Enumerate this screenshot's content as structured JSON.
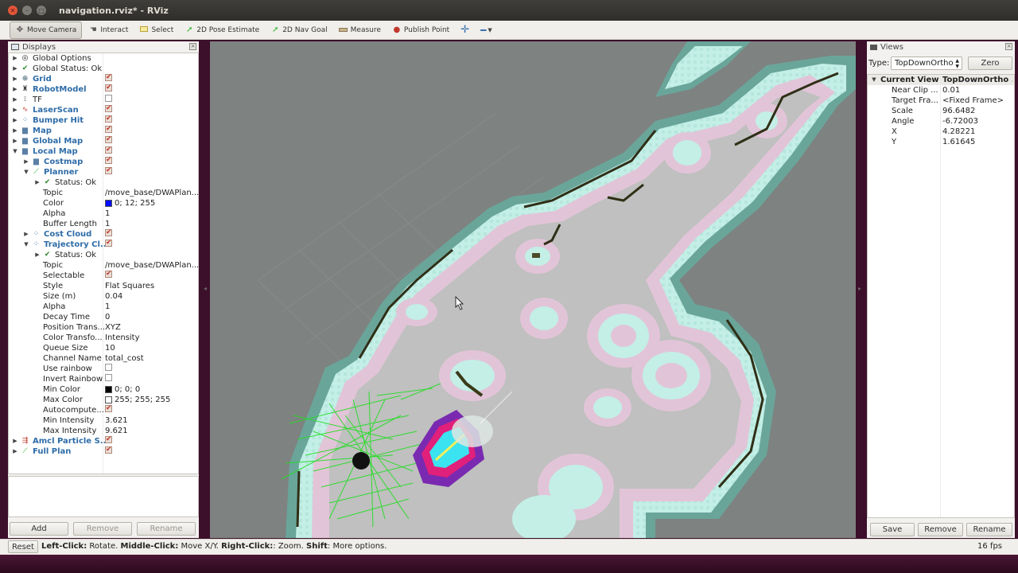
{
  "window": {
    "title": "navigation.rviz* - RViz"
  },
  "toolbar": {
    "tools": [
      {
        "label": "Move Camera",
        "icon": "camera-move-icon"
      },
      {
        "label": "Interact",
        "icon": "hand-icon"
      },
      {
        "label": "Select",
        "icon": "select-box-icon"
      },
      {
        "label": "2D Pose Estimate",
        "icon": "green-arrow-icon"
      },
      {
        "label": "2D Nav Goal",
        "icon": "green-arrow-icon"
      },
      {
        "label": "Measure",
        "icon": "ruler-icon"
      },
      {
        "label": "Publish Point",
        "icon": "map-pin-icon"
      }
    ]
  },
  "displays": {
    "title": "Displays",
    "rows": [
      {
        "label": "Global Options"
      },
      {
        "label": "Global Status: Ok"
      },
      {
        "label": "Grid"
      },
      {
        "label": "RobotModel"
      },
      {
        "label": "TF"
      },
      {
        "label": "LaserScan"
      },
      {
        "label": "Bumper Hit"
      },
      {
        "label": "Map"
      },
      {
        "label": "Global Map"
      },
      {
        "label": "Local Map"
      },
      {
        "label": "Costmap"
      },
      {
        "label": "Planner"
      },
      {
        "label": "Status: Ok"
      },
      {
        "label": "Topic",
        "value": "/move_base/DWAPlan..."
      },
      {
        "label": "Color",
        "value": "0; 12; 255"
      },
      {
        "label": "Alpha",
        "value": "1"
      },
      {
        "label": "Buffer Length",
        "value": "1"
      },
      {
        "label": "Cost Cloud"
      },
      {
        "label": "Trajectory Cl..."
      },
      {
        "label": "Status: Ok"
      },
      {
        "label": "Topic",
        "value": "/move_base/DWAPlan..."
      },
      {
        "label": "Selectable"
      },
      {
        "label": "Style",
        "value": "Flat Squares"
      },
      {
        "label": "Size (m)",
        "value": "0.04"
      },
      {
        "label": "Alpha",
        "value": "1"
      },
      {
        "label": "Decay Time",
        "value": "0"
      },
      {
        "label": "Position Trans...",
        "value": "XYZ"
      },
      {
        "label": "Color Transfo...",
        "value": "Intensity"
      },
      {
        "label": "Queue Size",
        "value": "10"
      },
      {
        "label": "Channel Name",
        "value": "total_cost"
      },
      {
        "label": "Use rainbow"
      },
      {
        "label": "Invert Rainbow"
      },
      {
        "label": "Min Color",
        "value": "0; 0; 0"
      },
      {
        "label": "Max Color",
        "value": "255; 255; 255"
      },
      {
        "label": "Autocompute..."
      },
      {
        "label": "Min Intensity",
        "value": "3.621"
      },
      {
        "label": "Max Intensity",
        "value": "9.621"
      },
      {
        "label": "Amcl Particle S..."
      },
      {
        "label": "Full Plan"
      }
    ],
    "buttons": {
      "add": "Add",
      "remove": "Remove",
      "rename": "Rename"
    }
  },
  "views": {
    "title": "Views",
    "type_label": "Type:",
    "type_value": "TopDownOrtho",
    "zero_label": "Zero",
    "header": {
      "name": "Current View",
      "value": "TopDownOrtho ..."
    },
    "rows": [
      {
        "label": "Near Clip ...",
        "value": "0.01"
      },
      {
        "label": "Target Fra...",
        "value": "<Fixed Frame>"
      },
      {
        "label": "Scale",
        "value": "96.6482"
      },
      {
        "label": "Angle",
        "value": "-6.72003"
      },
      {
        "label": "X",
        "value": "4.28221"
      },
      {
        "label": "Y",
        "value": "1.61645"
      }
    ],
    "buttons": {
      "save": "Save",
      "remove": "Remove",
      "rename": "Rename"
    }
  },
  "status": {
    "reset": "Reset",
    "left_click": "Left-Click:",
    "left_click_desc": " Rotate. ",
    "middle_click": "Middle-Click:",
    "middle_click_desc": " Move X/Y. ",
    "right_click": "Right-Click:",
    "right_click_desc": ": Zoom. ",
    "shift": "Shift",
    "shift_desc": ": More options.",
    "fps": "16 fps"
  },
  "colors": {
    "planner": "#000cff",
    "min_color": "#000000",
    "max_color": "#ffffff",
    "map_free": "#bfc0bf",
    "map_unknown": "#7e8280",
    "inflation_teal": "#6aa59a",
    "inflation_cyan": "#c3efe6",
    "inflation_pink": "#e2c4d8",
    "trajectory_green": "#22dd22"
  }
}
